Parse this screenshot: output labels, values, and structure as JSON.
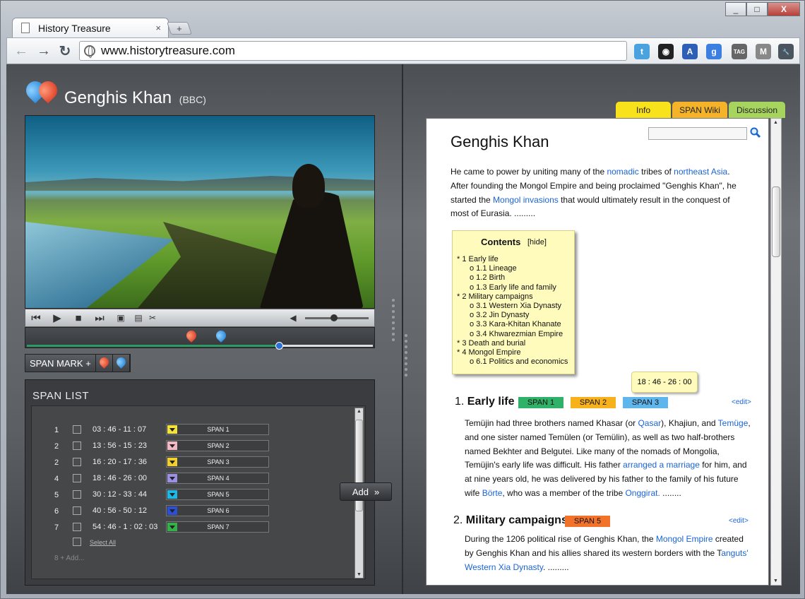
{
  "browser": {
    "tab_title": "History Treasure",
    "tab_close": "×",
    "new_tab": "+",
    "url": "www.historytreasure.com",
    "window_controls": [
      "_",
      "□",
      "X"
    ]
  },
  "extensions": [
    {
      "name": "twitter-icon",
      "glyph": "t",
      "color": "#4aa3df"
    },
    {
      "name": "color-wheel-icon",
      "glyph": "◉",
      "color": "#222"
    },
    {
      "name": "translate-icon",
      "glyph": "A",
      "color": "#2c5fb5"
    },
    {
      "name": "google-icon",
      "glyph": "g",
      "color": "#3b7fe0"
    },
    {
      "name": "tag-icon",
      "glyph": "TAG",
      "color": "#666"
    },
    {
      "name": "mail-icon",
      "glyph": "M",
      "color": "#888"
    },
    {
      "name": "wrench-icon",
      "glyph": "🔧",
      "color": "#4b5560"
    }
  ],
  "video": {
    "title": "Genghis Khan",
    "source": "(BBC)",
    "progress": 0.73,
    "volume": 0.45
  },
  "span_mark_label": "SPAN MARK",
  "span_mark_add": "+",
  "span_list": {
    "heading": "SPAN  LIST",
    "rows": [
      {
        "num": "1",
        "time": "03 : 46 - 11 : 07",
        "color": "#f3e23a",
        "label": "SPAN 1"
      },
      {
        "num": "2",
        "time": "13 : 56 - 15 : 23",
        "color": "#f4b7c4",
        "label": "SPAN 2"
      },
      {
        "num": "2",
        "time": "16 : 20 - 17 : 36",
        "color": "#f3cf2e",
        "label": "SPAN 3"
      },
      {
        "num": "4",
        "time": "18 : 46 - 26 : 00",
        "color": "#9d8fe6",
        "label": "SPAN 4"
      },
      {
        "num": "5",
        "time": "30 : 12 - 33 : 44",
        "color": "#1bb8e8",
        "label": "SPAN 5"
      },
      {
        "num": "6",
        "time": "40 : 56 - 50 : 12",
        "color": "#2b4fd6",
        "label": "SPAN 6"
      },
      {
        "num": "7",
        "time": "54 : 46 - 1 : 02 : 03",
        "color": "#34b24a",
        "label": "SPAN 7"
      }
    ],
    "select_all": "Select All",
    "add_row": "8  +  Add..."
  },
  "add_button": "Add",
  "right_tabs": [
    {
      "label": "Info",
      "color": "#f8e21b"
    },
    {
      "label": "SPAN Wiki",
      "color": "#f4b328"
    },
    {
      "label": "Discussion",
      "color": "#a6d45f"
    }
  ],
  "wiki": {
    "title": "Genghis Khan",
    "intro": [
      [
        "He came to power by uniting many of the ",
        "nomadic",
        " tribes of ",
        "northeast Asia",
        "."
      ],
      [
        "After founding the Mongol Empire and being proclaimed \"Genghis Khan\", he"
      ],
      [
        "started the ",
        "Mongol invasions",
        " that would ultimately result in the conquest of"
      ],
      [
        "most of Eurasia.    ........."
      ]
    ],
    "contents": {
      "title": "Contents",
      "hide": "[hide]",
      "lines": [
        {
          "text": "* 1 Early life",
          "indent": 0
        },
        {
          "text": "o 1.1 Lineage",
          "indent": 1
        },
        {
          "text": "o 1.2 Birth",
          "indent": 1
        },
        {
          "text": "o 1.3 Early life and family",
          "indent": 1
        },
        {
          "text": "* 2 Military campaigns",
          "indent": 0
        },
        {
          "text": "o 3.1 Western Xia Dynasty",
          "indent": 1
        },
        {
          "text": "o 3.2 Jin Dynasty",
          "indent": 1
        },
        {
          "text": "o 3.3 Kara-Khitan Khanate",
          "indent": 1
        },
        {
          "text": "o 3.4 Khwarezmian Empire",
          "indent": 1
        },
        {
          "text": "* 3 Death and burial",
          "indent": 0
        },
        {
          "text": "* 4 Mongol Empire",
          "indent": 0
        },
        {
          "text": "o 6.1 Politics and economics",
          "indent": 1
        }
      ]
    },
    "tooltip": "18 : 46 - 26 : 00",
    "section1": {
      "num": "1.",
      "title": "Early life",
      "badges": [
        {
          "label": "SPAN 1",
          "color": "#2fb267"
        },
        {
          "label": "SPAN 2",
          "color": "#f7b11b"
        },
        {
          "label": "SPAN 3",
          "color": "#5fb6ec"
        }
      ],
      "edit": "<edit>",
      "lines": [
        [
          "Temüjin had three brothers named Khasar (or ",
          "Qasar",
          "), Khajiun, and ",
          "Temüge",
          ","
        ],
        [
          "and one sister named Temülen (or Temülin), as well as two half-brothers"
        ],
        [
          "named Bekhter and Belgutei. Like many of the nomads of Mongolia,"
        ],
        [
          "Temüjin's early life was difficult. His father ",
          "arranged a marriage",
          " for him, and"
        ],
        [
          "at nine years old, he was delivered by his father to the family of his future"
        ],
        [
          "wife ",
          "Börte",
          ", who was a member of the tribe ",
          "Onggirat.",
          "     ........"
        ]
      ]
    },
    "section2": {
      "num": "2.",
      "title": "Military campaigns",
      "badges": [
        {
          "label": "SPAN 5",
          "color": "#f2722a"
        }
      ],
      "edit": "<edit>",
      "lines": [
        [
          "During the 1206 political rise of Genghis Khan, the ",
          "Mongol Empire",
          " created"
        ],
        [
          "by Genghis Khan and his allies shared its western borders with the T",
          "anguts'",
          ""
        ],
        [
          "",
          "Western Xia Dynasty",
          ".     ........."
        ]
      ]
    }
  }
}
